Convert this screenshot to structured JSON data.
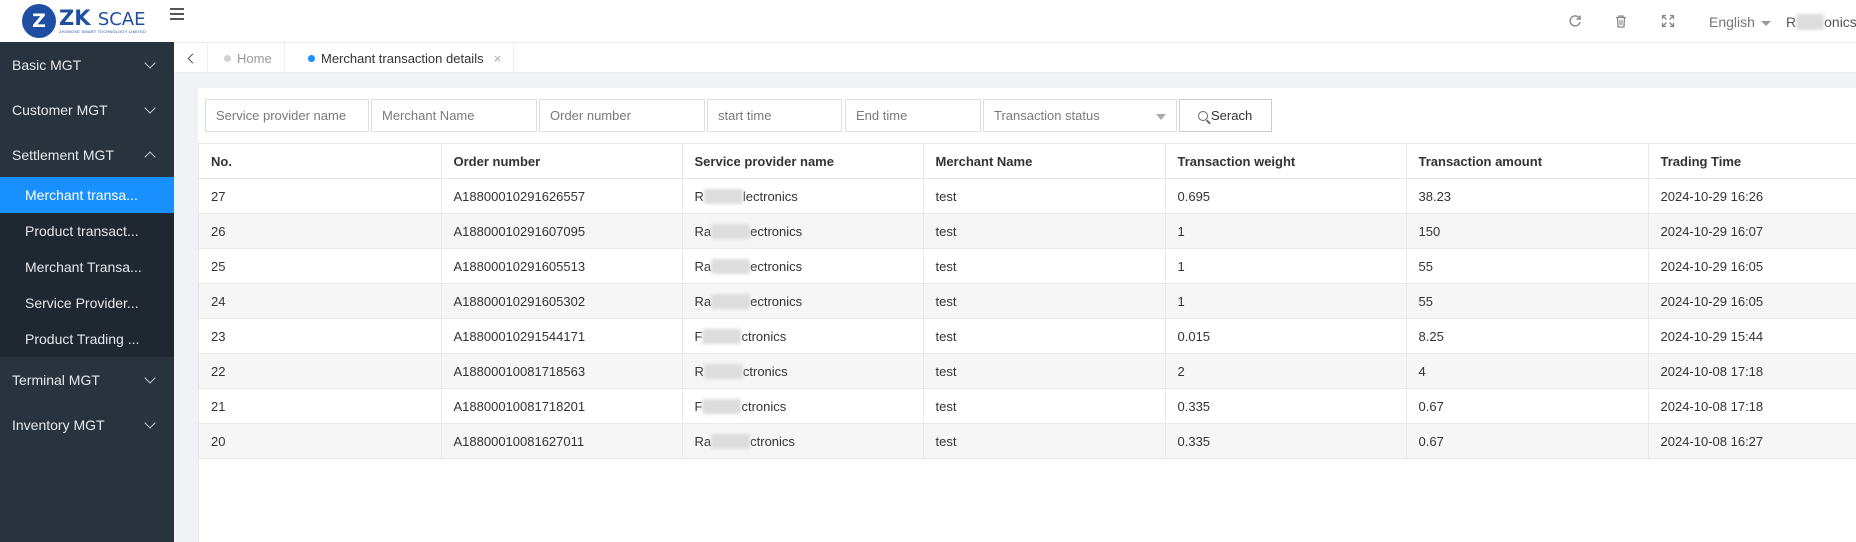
{
  "logo": {
    "mark": "Z",
    "main": "ZK",
    "scae": "SCAE",
    "sub": "ZHONGKE SMART TECHNOLOGY LIMITED"
  },
  "sidebar": {
    "groups": [
      {
        "label": "Basic MGT",
        "open": false
      },
      {
        "label": "Customer MGT",
        "open": false
      },
      {
        "label": "Settlement MGT",
        "open": true
      },
      {
        "label": "Terminal MGT",
        "open": false
      },
      {
        "label": "Inventory MGT",
        "open": false
      }
    ],
    "settlement_items": [
      {
        "label": "Merchant transa...",
        "active": true
      },
      {
        "label": "Product transact...",
        "active": false
      },
      {
        "label": "Merchant Transa...",
        "active": false
      },
      {
        "label": "Service Provider...",
        "active": false
      },
      {
        "label": "Product Trading ...",
        "active": false
      }
    ]
  },
  "header": {
    "language": "English",
    "user_prefix": "R",
    "user_suffix": "onics"
  },
  "tabs": [
    {
      "label": "Home",
      "active": false
    },
    {
      "label": "Merchant transaction details",
      "active": true,
      "close": "×"
    }
  ],
  "filters": {
    "service_provider_name": "Service provider name",
    "merchant_name": "Merchant Name",
    "order_number": "Order number",
    "start_time": "start time",
    "end_time": "End time",
    "transaction_status": "Transaction status",
    "search_label": "Serach"
  },
  "table": {
    "columns": [
      "No.",
      "Order number",
      "Service provider name",
      "Merchant Name",
      "Transaction weight",
      "Transaction amount",
      "Trading Time"
    ],
    "rows": [
      {
        "no": "27",
        "order": "A18800010291626557",
        "sp_a": "R",
        "sp_b": "lectronics",
        "merchant": "test",
        "weight": "0.695",
        "amount": "38.23",
        "time": "2024-10-29 16:26"
      },
      {
        "no": "26",
        "order": "A18800010291607095",
        "sp_a": "Ra",
        "sp_b": "ectronics",
        "merchant": "test",
        "weight": "1",
        "amount": "150",
        "time": "2024-10-29 16:07"
      },
      {
        "no": "25",
        "order": "A18800010291605513",
        "sp_a": "Ra",
        "sp_b": "ectronics",
        "merchant": "test",
        "weight": "1",
        "amount": "55",
        "time": "2024-10-29 16:05"
      },
      {
        "no": "24",
        "order": "A18800010291605302",
        "sp_a": "Ra",
        "sp_b": "ectronics",
        "merchant": "test",
        "weight": "1",
        "amount": "55",
        "time": "2024-10-29 16:05"
      },
      {
        "no": "23",
        "order": "A18800010291544171",
        "sp_a": "F",
        "sp_b": "ctronics",
        "merchant": "test",
        "weight": "0.015",
        "amount": "8.25",
        "time": "2024-10-29 15:44"
      },
      {
        "no": "22",
        "order": "A18800010081718563",
        "sp_a": "R",
        "sp_b": "ctronics",
        "merchant": "test",
        "weight": "2",
        "amount": "4",
        "time": "2024-10-08 17:18"
      },
      {
        "no": "21",
        "order": "A18800010081718201",
        "sp_a": "F",
        "sp_b": "ctronics",
        "merchant": "test",
        "weight": "0.335",
        "amount": "0.67",
        "time": "2024-10-08 17:18"
      },
      {
        "no": "20",
        "order": "A18800010081627011",
        "sp_a": "Ra",
        "sp_b": "ctronics",
        "merchant": "test",
        "weight": "0.335",
        "amount": "0.67",
        "time": "2024-10-08 16:27"
      }
    ]
  },
  "icons": {
    "refresh": "refresh-icon",
    "delete": "trash-icon",
    "fullscreen": "fullscreen-icon",
    "menu_toggle": "menu-toggle-icon"
  }
}
